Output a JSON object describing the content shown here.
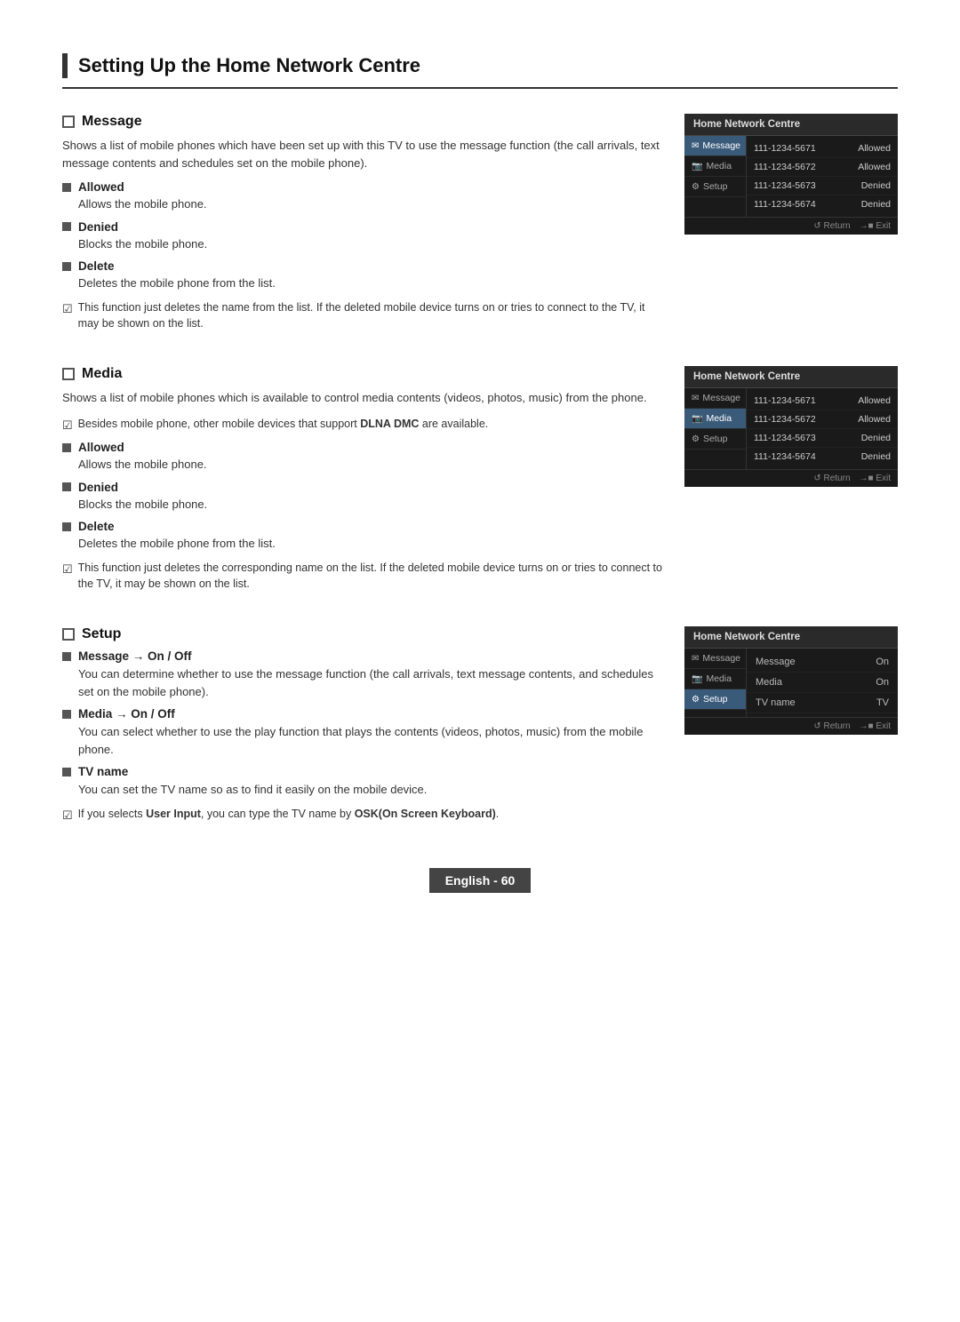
{
  "page": {
    "title": "Setting Up the Home Network Centre",
    "footer_label": "English - 60"
  },
  "sections": [
    {
      "id": "message",
      "heading": "Message",
      "description": "Shows a list of mobile phones which have been set up with this TV to use the message function (the call arrivals, text message contents and schedules set on the mobile phone).",
      "sub_items": [
        {
          "label": "Allowed",
          "desc": "Allows the mobile phone."
        },
        {
          "label": "Denied",
          "desc": "Blocks the mobile phone."
        },
        {
          "label": "Delete",
          "desc": "Deletes the mobile phone from the list."
        }
      ],
      "note": "This function just deletes the name from the list. If the deleted mobile device turns on or tries to connect to the TV, it may be shown on the list.",
      "panel": {
        "title": "Home Network Centre",
        "menu_items": [
          {
            "label": "Message",
            "icon": "✉",
            "active": true
          },
          {
            "label": "Media",
            "icon": "📷",
            "active": false
          },
          {
            "label": "Setup",
            "icon": "⚙",
            "active": false
          }
        ],
        "rows": [
          {
            "number": "111-1234-5671",
            "status": "Allowed"
          },
          {
            "number": "111-1234-5672",
            "status": "Allowed"
          },
          {
            "number": "111-1234-5673",
            "status": "Denied"
          },
          {
            "number": "111-1234-5674",
            "status": "Denied"
          }
        ],
        "footer_return": "↺ Return",
        "footer_exit": "→■ Exit"
      }
    },
    {
      "id": "media",
      "heading": "Media",
      "description": "Shows a list of mobile phones which is available to control media contents (videos, photos, music) from the phone.",
      "dlna_note": "Besides mobile phone, other mobile devices that support DLNA DMC are available.",
      "sub_items": [
        {
          "label": "Allowed",
          "desc": "Allows the mobile phone."
        },
        {
          "label": "Denied",
          "desc": "Blocks the mobile phone."
        },
        {
          "label": "Delete",
          "desc": "Deletes the mobile phone from the list."
        }
      ],
      "note": "This function just deletes the corresponding name on the list. If the deleted mobile device turns on or tries to connect to the TV, it may be shown on the list.",
      "panel": {
        "title": "Home Network Centre",
        "menu_items": [
          {
            "label": "Message",
            "icon": "✉",
            "active": false
          },
          {
            "label": "Media",
            "icon": "📷",
            "active": true
          },
          {
            "label": "Setup",
            "icon": "⚙",
            "active": false
          }
        ],
        "rows": [
          {
            "number": "111-1234-5671",
            "status": "Allowed"
          },
          {
            "number": "111-1234-5672",
            "status": "Allowed"
          },
          {
            "number": "111-1234-5673",
            "status": "Denied"
          },
          {
            "number": "111-1234-5674",
            "status": "Denied"
          }
        ],
        "footer_return": "↺ Return",
        "footer_exit": "→■ Exit"
      }
    },
    {
      "id": "setup",
      "heading": "Setup",
      "sub_items": [
        {
          "label": "Message → On / Off",
          "desc": "You can determine whether to use the message function (the call arrivals, text message contents, and schedules set on the mobile phone)."
        },
        {
          "label": "Media → On / Off",
          "desc": "You can select whether to use the play function that plays the contents (videos, photos, music) from the mobile phone."
        },
        {
          "label": "TV name",
          "desc": "You can set the TV name so as to find it easily on the mobile device."
        }
      ],
      "note": "If you selects User Input, you can type the TV name by OSK(On Screen Keyboard).",
      "panel": {
        "title": "Home Network Centre",
        "menu_items": [
          {
            "label": "Message",
            "icon": "✉",
            "active": false
          },
          {
            "label": "Media",
            "icon": "📷",
            "active": false
          },
          {
            "label": "Setup",
            "icon": "⚙",
            "active": true
          }
        ],
        "setup_rows": [
          {
            "label": "Message",
            "value": "On"
          },
          {
            "label": "Media",
            "value": "On"
          },
          {
            "label": "TV name",
            "value": "TV"
          }
        ],
        "footer_return": "↺ Return",
        "footer_exit": "→■ Exit"
      }
    }
  ]
}
